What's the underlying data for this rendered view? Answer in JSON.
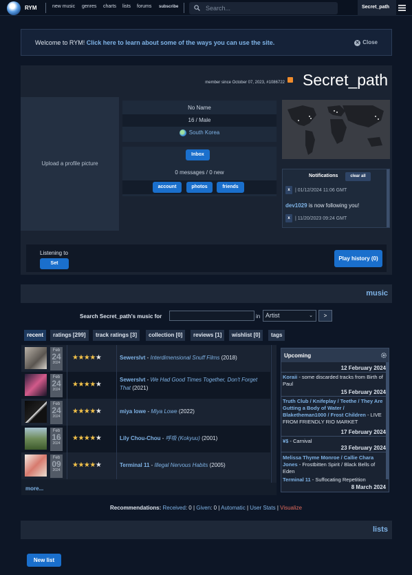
{
  "nav": {
    "brand": "RYM",
    "links": [
      "new music",
      "genres",
      "charts",
      "lists",
      "forums",
      "subscribe"
    ],
    "search_placeholder": "Search...",
    "username": "Secret_path"
  },
  "welcome": {
    "prefix": "Welcome to RYM!",
    "link": "Click here to learn about some of the ways you can use the site.",
    "close": "Close"
  },
  "profile": {
    "member_since": "member since October 07, 2023, #1086722",
    "username": "Secret_path",
    "upload_text": "Upload a profile picture",
    "name": "No Name",
    "age_gender": "16 / Male",
    "country": "South Korea",
    "inbox": "Inbox",
    "messages": "0 messages / 0 new",
    "account": "account",
    "photos": "photos",
    "friends": "friends"
  },
  "notifications": {
    "title": "Notifications",
    "clear_all": "clear all",
    "items": [
      {
        "x": "x",
        "date": "| 01/12/2024 11:06 GMT"
      },
      {
        "x": "x",
        "date": "| 11/20/2023 09:24 GMT"
      }
    ],
    "follower": "dev1029",
    "follow_text": "is now following you!"
  },
  "listening": {
    "label": "Listening to",
    "set": "Set",
    "play_history": "Play history (0)"
  },
  "music": {
    "title": "music",
    "search_label": "Search Secret_path's music for",
    "in": "in",
    "select_value": "Artist",
    "go": ">",
    "tabs": [
      "recent",
      "ratings [299]",
      "track ratings [3]",
      "collection [0]",
      "reviews [1]",
      "wishlist [0]",
      "tags"
    ],
    "more": "more..."
  },
  "ratings": [
    {
      "mon": "Feb",
      "day": "24",
      "year": "2024",
      "stars": 4,
      "artist": "Sewerslvt",
      "album": "Interdimensional Snuff Films",
      "year_rel": "(2018)"
    },
    {
      "mon": "Feb",
      "day": "24",
      "year": "2024",
      "stars": 4,
      "artist": "Sewerslvt",
      "album": "We Had Good Times Together, Don't Forget That",
      "year_rel": "(2021)"
    },
    {
      "mon": "Feb",
      "day": "24",
      "year": "2024",
      "stars": 4,
      "artist": "miya lowe",
      "album": "Miya Lowe",
      "year_rel": "(2022)"
    },
    {
      "mon": "Feb",
      "day": "16",
      "year": "2024",
      "stars": 4,
      "artist": "Lily Chou-Chou",
      "album": "呼吸 (Kokyuu)",
      "year_rel": "(2001)"
    },
    {
      "mon": "Feb",
      "day": "09",
      "year": "2024",
      "stars": 4,
      "artist": "Terminal 11",
      "album": "Illegal Nervous Habits",
      "year_rel": "(2005)"
    }
  ],
  "upcoming": {
    "title": "Upcoming",
    "d1": "12 February 2024",
    "i1_artist": "Koraii",
    "i1_rest": " - some discarded tracks from Birth of Paul",
    "d2": "15 February 2024",
    "i2_artists": "Truth Club / Knifeplay / Teethe / They Are Gutting a Body of Water / Blaketheman1000 / Frost Children",
    "i2_rest": " - LIVE FROM FRIENDLY RIO MARKET",
    "d3": "17 February 2024",
    "i3_artist": "¥$",
    "i3_rest": " - Carnival",
    "d4": "23 February 2024",
    "i4_artists": "Melissa Thyme Monroe / Callie Chara Jones",
    "i4_rest": " - Frostbitten Spirit / Black Bells of Eden",
    "i5_artist": "Terminal 11",
    "i5_rest": " - Suffocating Repetition",
    "d5": "8 March 2024"
  },
  "recs": {
    "label": "Recommendations:",
    "received": "Received",
    "received_n": ": 0 | ",
    "given": "Given",
    "given_n": ": 0 | ",
    "automatic": "Automatic",
    "sep1": " | ",
    "user_stats": "User Stats",
    "sep2": " | ",
    "visualize": "Visualize"
  },
  "lists": {
    "title": "lists",
    "new_list": "New list"
  }
}
